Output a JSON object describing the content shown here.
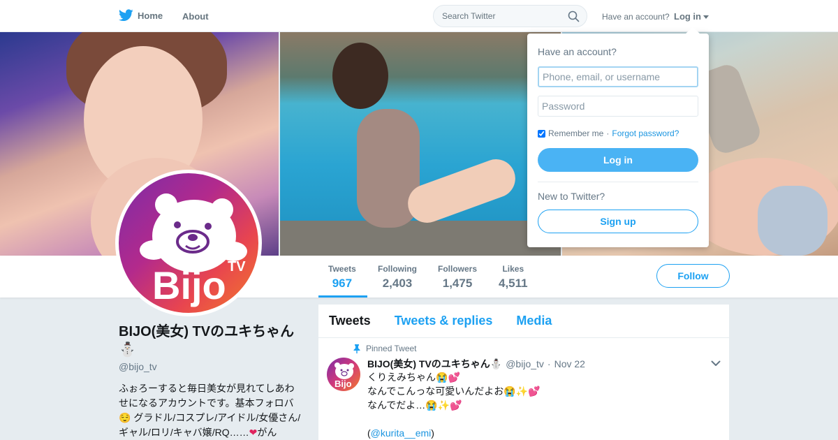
{
  "nav": {
    "home_label": "Home",
    "about_label": "About",
    "search_placeholder": "Search Twitter",
    "have_account": "Have an account?",
    "login_label": "Log in"
  },
  "profile": {
    "avatar_text": "Bijo",
    "avatar_tv": "TV",
    "name": "BIJO(美女) TVのユキちゃん",
    "name_emoji": "⛄",
    "handle": "@bijo_tv",
    "bio_1": "ふぉろーすると毎日美女が見れてしあわせになるアカウントです。基本フォロバ",
    "bio_emoji_1": "😌",
    "bio_2": " グラドル/コスプレ/アイドル/女優さん/ギャル/ロリ/キャバ嬢/RQ……",
    "bio_emoji_2": "❤",
    "bio_3": "がん"
  },
  "stats": [
    {
      "label": "Tweets",
      "value": "967"
    },
    {
      "label": "Following",
      "value": "2,403"
    },
    {
      "label": "Followers",
      "value": "1,475"
    },
    {
      "label": "Likes",
      "value": "4,511"
    }
  ],
  "follow_label": "Follow",
  "timeline": {
    "tabs": [
      "Tweets",
      "Tweets & replies",
      "Media"
    ],
    "pinned_label": "Pinned Tweet",
    "tweet": {
      "name": "BIJO(美女) TVのユキちゃん",
      "name_emoji": "⛄",
      "handle": "@bijo_tv",
      "sep": "·",
      "date": "Nov 22",
      "line1": "くりえみちゃん",
      "line2": "なんでこんっな可愛いんだよお",
      "line3": "なんでだよ…",
      "mention_open": "(",
      "mention": "@kurita__emi",
      "mention_close": ")",
      "emoji_cry": "😭",
      "emoji_heart": "💕",
      "emoji_sparkle": "✨"
    }
  },
  "login_dropdown": {
    "heading": "Have an account?",
    "username_placeholder": "Phone, email, or username",
    "password_placeholder": "Password",
    "remember_label": "Remember me",
    "separator": "·",
    "forgot_label": "Forgot password?",
    "login_button": "Log in",
    "new_label": "New to Twitter?",
    "signup_button": "Sign up"
  },
  "colors": {
    "accent": "#1da1f2",
    "login_button": "#4ab3f4",
    "background": "#e6ecf0"
  }
}
